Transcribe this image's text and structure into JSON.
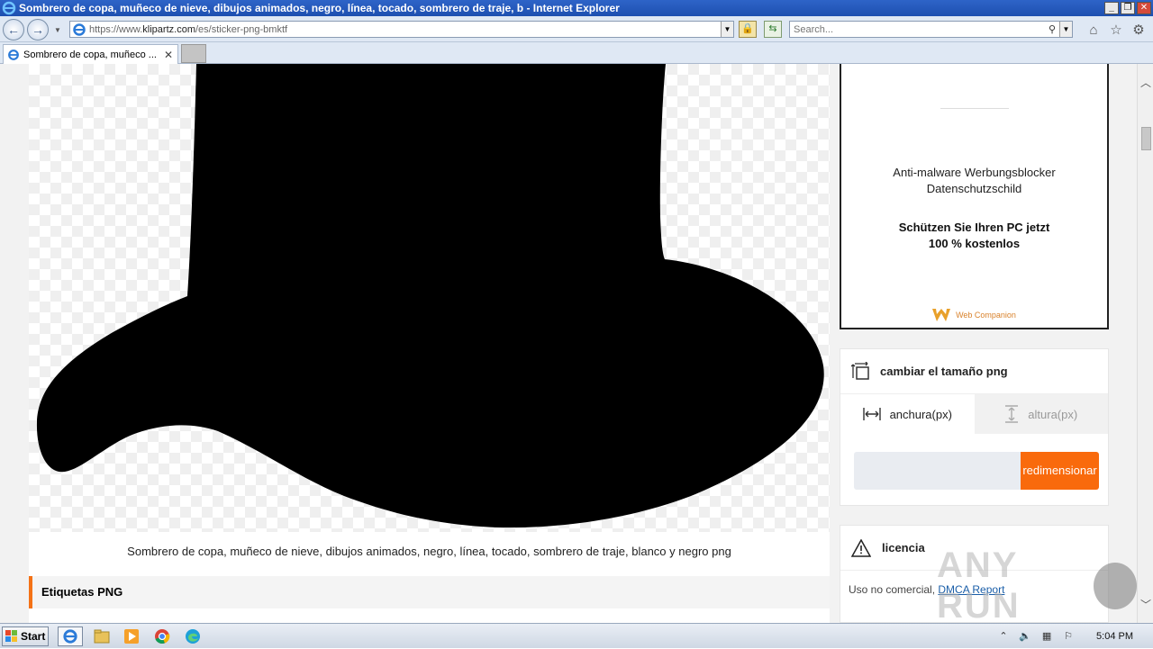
{
  "window": {
    "title": "Sombrero de copa, muñeco de nieve, dibujos animados, negro, línea, tocado, sombrero de traje, b - Internet Explorer",
    "minimize": "_",
    "restore": "❐",
    "close": "✕"
  },
  "address_bar": {
    "url_prefix": "https://www.",
    "url_host": "klipartz.com",
    "url_path": "/es/sticker-png-bmktf",
    "search_placeholder": "Search..."
  },
  "tab": {
    "label": "Sombrero de copa, muñeco ...",
    "close": "✕"
  },
  "page": {
    "caption": "Sombrero de copa, muñeco de nieve, dibujos animados, negro, línea, tocado, sombrero de traje, blanco y negro png",
    "tags_heading": "Etiquetas PNG"
  },
  "ad": {
    "line1a": "Anti-malware Werbungsblocker",
    "line1b": "Datenschutzschild",
    "line2a": "Schützen Sie Ihren PC jetzt",
    "line2b": "100 % kostenlos",
    "brand": "Web Companion"
  },
  "resize_widget": {
    "title": "cambiar el tamaño png",
    "tab_width": "anchura(px)",
    "tab_height": "altura(px)",
    "button": "redimensionar"
  },
  "license": {
    "title": "licencia",
    "text": "Uso no comercial, ",
    "link": "DMCA Report"
  },
  "watermark": {
    "text": "ANY RUN"
  },
  "taskbar": {
    "start": "Start",
    "clock": "5:04 PM"
  },
  "colors": {
    "accent": "#f96a0c",
    "title_bar": "#2e64c8",
    "link": "#1a5ea8"
  }
}
